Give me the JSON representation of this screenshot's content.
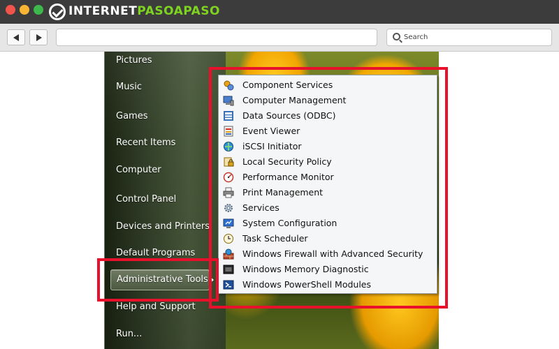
{
  "browser": {
    "logo_text_a": "INTERNET",
    "logo_text_b": "PASOAPASO",
    "search_placeholder": "Search",
    "colors": {
      "titlebar": "#3c3c3c",
      "brand_green": "#7ed321",
      "close": "#f2544c",
      "minimize": "#f8b533",
      "maximize": "#3cb84c"
    }
  },
  "start_menu": {
    "items": [
      {
        "label": "Pictures"
      },
      {
        "label": "Music"
      },
      {
        "label": "Games"
      },
      {
        "label": "Recent Items"
      },
      {
        "label": "Computer"
      },
      {
        "label": "Control Panel"
      },
      {
        "label": "Devices and Printers"
      },
      {
        "label": "Default Programs"
      },
      {
        "label": "Administrative Tools",
        "highlighted": true,
        "has_submenu": true
      },
      {
        "label": "Help and Support"
      },
      {
        "label": "Run..."
      }
    ]
  },
  "admin_tools": {
    "items": [
      {
        "label": "Component Services",
        "icon": "component-services-icon"
      },
      {
        "label": "Computer Management",
        "icon": "computer-management-icon"
      },
      {
        "label": "Data Sources (ODBC)",
        "icon": "data-sources-icon"
      },
      {
        "label": "Event Viewer",
        "icon": "event-viewer-icon"
      },
      {
        "label": "iSCSI Initiator",
        "icon": "iscsi-initiator-icon"
      },
      {
        "label": "Local Security Policy",
        "icon": "local-security-policy-icon"
      },
      {
        "label": "Performance Monitor",
        "icon": "performance-monitor-icon"
      },
      {
        "label": "Print Management",
        "icon": "print-management-icon"
      },
      {
        "label": "Services",
        "icon": "services-icon"
      },
      {
        "label": "System Configuration",
        "icon": "system-configuration-icon"
      },
      {
        "label": "Task Scheduler",
        "icon": "task-scheduler-icon"
      },
      {
        "label": "Windows Firewall with Advanced Security",
        "icon": "firewall-icon"
      },
      {
        "label": "Windows Memory Diagnostic",
        "icon": "memory-diagnostic-icon"
      },
      {
        "label": "Windows PowerShell Modules",
        "icon": "powershell-icon"
      }
    ]
  },
  "annotations": {
    "highlight_color": "#e8102a"
  }
}
